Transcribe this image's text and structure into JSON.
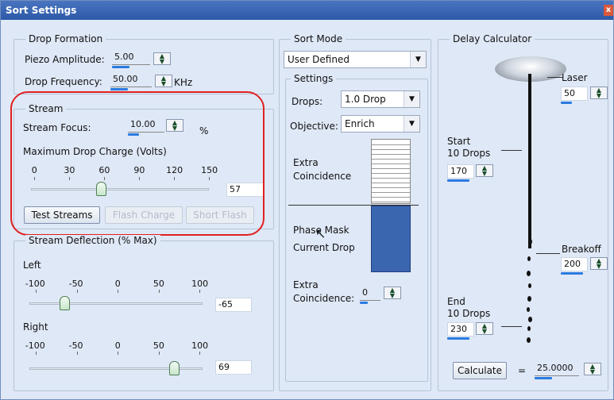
{
  "window": {
    "title": "Sort Settings",
    "close_glyph": "x"
  },
  "drop_formation": {
    "legend": "Drop Formation",
    "piezo_label": "Piezo Amplitude:",
    "piezo_value": "5.00",
    "freq_label": "Drop Frequency:",
    "freq_value": "50.00",
    "freq_unit": "KHz"
  },
  "stream": {
    "legend": "Stream",
    "focus_label": "Stream Focus:",
    "focus_value": "10.00",
    "focus_unit": "%",
    "charge_label": "Maximum Drop Charge (Volts)",
    "ticks": [
      "0",
      "30",
      "60",
      "90",
      "120",
      "150"
    ],
    "charge_value": "57",
    "charge_level": 57,
    "buttons": {
      "test": "Test Streams",
      "flash": "Flash Charge",
      "short": "Short Flash"
    }
  },
  "deflection": {
    "legend": "Stream Deflection (% Max)",
    "left_label": "Left",
    "right_label": "Right",
    "ticks": [
      "-100",
      "-50",
      "0",
      "50",
      "100"
    ],
    "left_value": "-65",
    "left_level": -65,
    "right_value": "69",
    "right_level": 69
  },
  "sort_mode": {
    "legend": "Sort Mode",
    "mode_value": "User Defined",
    "settings_legend": "Settings",
    "drops_label": "Drops:",
    "drops_value": "1.0 Drop",
    "objective_label": "Objective:",
    "objective_value": "Enrich",
    "extra_label": "Extra\nCoincidence",
    "phase_label": "Phase Mask",
    "current_label": "Current Drop",
    "extra2_label": "Extra\nCoincidence:",
    "extra2_value": "0"
  },
  "delay_calc": {
    "legend": "Delay Calculator",
    "laser_label": "Laser",
    "laser_value": "50",
    "start_label": "Start\n10 Drops",
    "start_value": "170",
    "breakoff_label": "Breakoff",
    "breakoff_value": "200",
    "end_label": "End\n10 Drops",
    "end_value": "230",
    "calc_button": "Calculate",
    "equals": "=",
    "result_value": "25.0000"
  },
  "colors": {
    "accent": "#2b7be0",
    "title_bar": "#2c59a8",
    "highlight": "#e02020",
    "stream_blue": "#3a66b0"
  }
}
